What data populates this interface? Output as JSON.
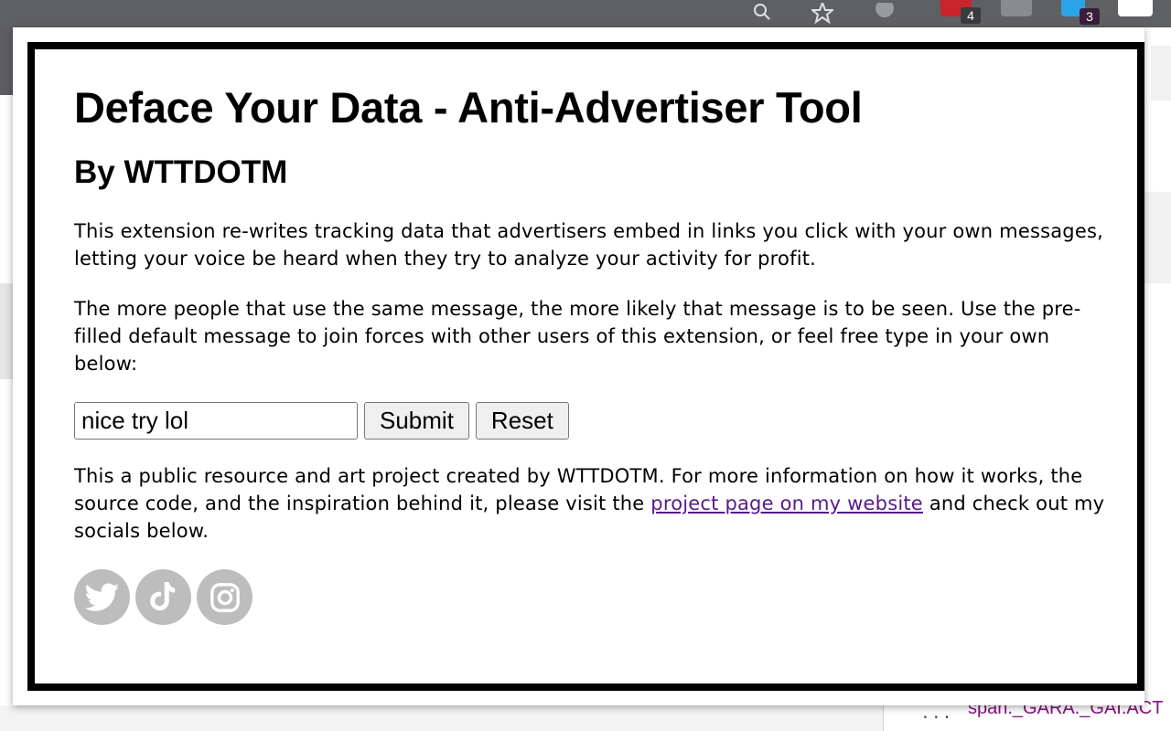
{
  "browser": {
    "extension_badges": [
      "4",
      "3"
    ],
    "colors": {
      "chrome_bar": "#5f6063",
      "badge_red_ext": "#c8252c",
      "badge_blue_ext": "#2aa4e6"
    }
  },
  "popup": {
    "title": "Deface Your Data - Anti-Advertiser Tool",
    "byline": "By WTTDOTM",
    "intro": "This extension re-writes tracking data that advertisers embed in links you click with your own messages, letting your voice be heard when they try to analyze your activity for profit.",
    "instructions": "The more people that use the same message, the more likely that message is to be seen. Use the pre-filled default message to join forces with other users of this extension, or feel free type in your own below:",
    "form": {
      "message_value": "nice try lol",
      "submit_label": "Submit",
      "reset_label": "Reset"
    },
    "footer": {
      "text_before_link": "This a public resource and art project created by WTTDOTM. For more information on how it works, the source code, and the inspiration behind it, please visit the ",
      "link_text": "project page on my website",
      "text_after_link": " and check out my socials below."
    },
    "socials": [
      {
        "icon": "twitter-icon"
      },
      {
        "icon": "tiktok-icon"
      },
      {
        "icon": "instagram-icon"
      }
    ],
    "colors": {
      "frame": "#000000",
      "link": "#551a8b",
      "social_bg": "#bdbdbd"
    }
  },
  "devtools": {
    "selector_text": "span._GARA._GAI.ACT",
    "ellipsis": "..."
  }
}
